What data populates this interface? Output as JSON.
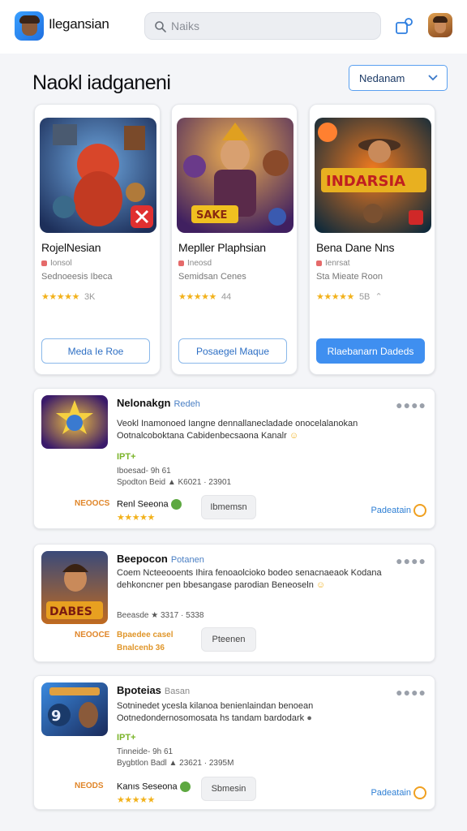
{
  "header": {
    "app_name": "Ilegansian",
    "search_placeholder": "Naiks",
    "icons": [
      "app-logo-icon",
      "search-icon",
      "share-icon",
      "avatar-icon"
    ]
  },
  "page": {
    "heading": "Naokl iadganeni",
    "sort_label": "Nedanam"
  },
  "featured": [
    {
      "title": "RojelNesian",
      "meta": "Ionsol",
      "genre": "Sednoeesis Ibeca",
      "rating": "3K",
      "button": "Meda Ie Roe",
      "primary": false
    },
    {
      "title": "Mepller Plaphsian",
      "meta": "Ineosd",
      "genre": "Semidsan Cenes",
      "rating": "44",
      "button": "Posaegel Maque",
      "primary": false
    },
    {
      "title": "Bena Dane Nns",
      "meta": "Ienrsat",
      "genre": "Sta Mieate Roon",
      "rating": "5B",
      "button": "Rlaebanarn Dadeds",
      "primary": true
    }
  ],
  "list": [
    {
      "name": "Nelonakgn",
      "sub": "Redeh",
      "desc": "Veokl Inamonoed Iangne dennallanecladade onocelalanokan Ootnalcoboktana Cabidenbecsaona Kanalr",
      "tag": "IPT+",
      "info1": "Iboesad- 9h  61",
      "info2": "Spodton Beid  ▲  K6021 · 23901",
      "badge": "NEOOCS",
      "dev": "Renl Seeona",
      "ghost": "Ibmemsn",
      "link": "Padeatain"
    },
    {
      "name": "Beepocon",
      "sub": "Potanen",
      "desc": "Coem Ncteeooents Ihira fenoaolcioko bodeo senacnaeaok Kodana dehkoncner pen bbesangase parodian Beneoseln",
      "tag": "",
      "info1": "Beeasde  ★  3317 · 5338",
      "info2": "",
      "badge": "NEOOCE",
      "dev": "Bpaedee casel",
      "dev2": "Bnalcenb 36",
      "ghost": "Pteenen",
      "link": ""
    },
    {
      "name": "Bpoteias",
      "sub": "Basan",
      "desc": "Sotninedet ycesla kilanoa benienlaindan benoean Ootnedondernosomosata hs tandam bardodark",
      "tag": "IPT+",
      "info1": "Tinneide- 9h  61",
      "info2": "Bygbtlon Badl  ▲  23621 · 2395M",
      "badge": "NEODS",
      "dev": "Kanıs Seseona",
      "ghost": "Sbmesin",
      "link": "Padeatain"
    }
  ],
  "colors": {
    "accent": "#3f8ff0",
    "star": "#f2b21c",
    "badge": "#e0862a",
    "tag": "#7bb42a"
  }
}
